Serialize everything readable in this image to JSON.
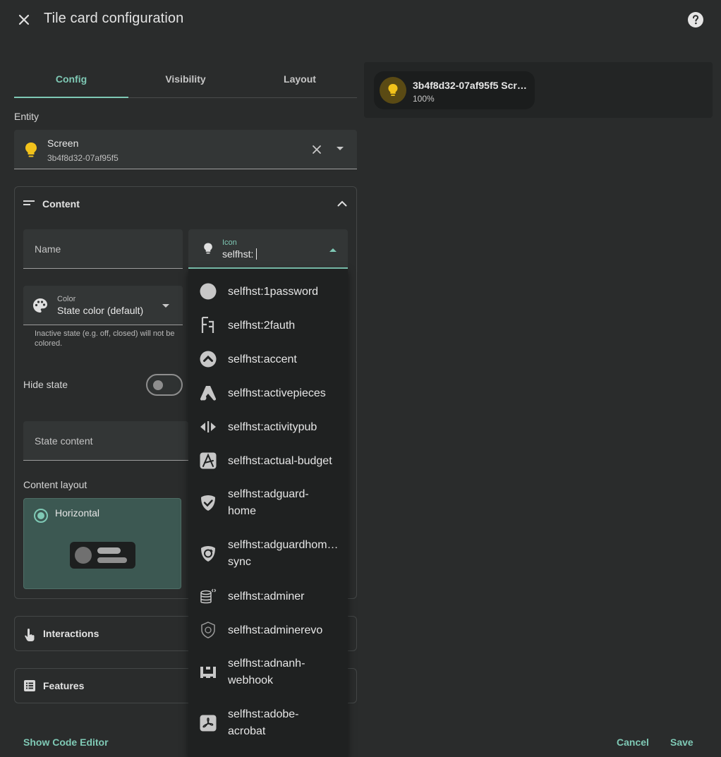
{
  "header": {
    "title": "Tile card configuration",
    "close_icon": "close-icon",
    "help_icon": "help-circle-icon"
  },
  "tabs": [
    "Config",
    "Visibility",
    "Layout"
  ],
  "entity": {
    "label": "Entity",
    "name": "Screen",
    "id": "3b4f8d32-07af95f5",
    "icon": "lightbulb-icon",
    "icon_color": "#f2c21b"
  },
  "content": {
    "title": "Content",
    "name_label": "Name",
    "icon_field": {
      "label": "Icon",
      "value": "selfhst:"
    },
    "color": {
      "label": "Color",
      "value": "State color (default)"
    },
    "color_helper": "Inactive state (e.g. off, closed) will not be colored.",
    "hide_state_label": "Hide state",
    "state_content_label": "State content",
    "content_layout_label": "Content layout",
    "layout_option": "Horizontal"
  },
  "interactions_label": "Interactions",
  "features_label": "Features",
  "icon_options": [
    "selfhst:1password",
    "selfhst:2fauth",
    "selfhst:accent",
    "selfhst:activepieces",
    "selfhst:activitypub",
    "selfhst:actual-budget",
    "selfhst:adguard-\nhome",
    "selfhst:adguardhom…",
    "sync",
    "selfhst:adminer",
    "selfhst:adminerevo",
    "selfhst:adnanh-\nwebhook",
    "selfhst:adobe-\nacrobat"
  ],
  "preview": {
    "name": "3b4f8d32-07af95f5 Scr…",
    "state": "100%"
  },
  "footer": {
    "code_editor": "Show Code Editor",
    "cancel": "Cancel",
    "save": "Save"
  },
  "colors": {
    "accent": "#7fc9b5",
    "bulb": "#f2c21b",
    "background": "#2a2c2c"
  }
}
